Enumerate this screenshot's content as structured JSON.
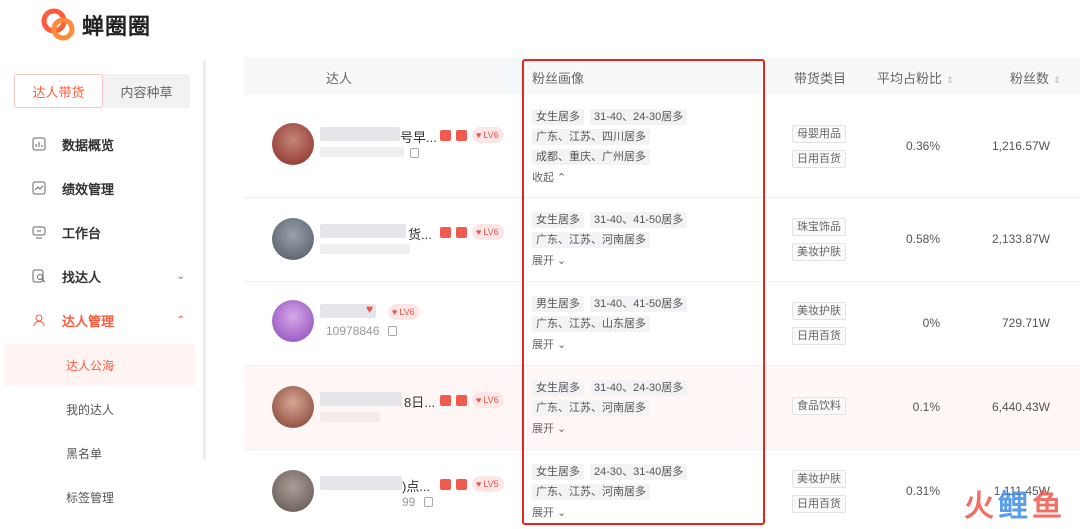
{
  "brand": {
    "name": "蝉圈圈",
    "accent": "#ff5a3c"
  },
  "sidebar": {
    "tabs": [
      {
        "label": "达人带货",
        "active": true
      },
      {
        "label": "内容种草",
        "active": false
      }
    ],
    "items": [
      {
        "label": "数据概览",
        "icon": "chart-icon"
      },
      {
        "label": "绩效管理",
        "icon": "trend-icon"
      },
      {
        "label": "工作台",
        "icon": "monitor-icon"
      },
      {
        "label": "找达人",
        "icon": "search-user-icon",
        "chevron": "⌄"
      },
      {
        "label": "达人管理",
        "icon": "user-icon",
        "chevron": "⌃",
        "open": true
      }
    ],
    "subitems": [
      {
        "label": "达人公海",
        "active": true
      },
      {
        "label": "我的达人"
      },
      {
        "label": "黑名单"
      },
      {
        "label": "标签管理"
      }
    ]
  },
  "table": {
    "headers": {
      "creator": "达人",
      "fans_profile": "粉丝画像",
      "category": "带货类目",
      "avg_ratio": "平均占粉比",
      "fans": "粉丝数",
      "sort": "⇕"
    },
    "rows": [
      {
        "name_tail": "号早...",
        "level": "LV6",
        "sub": "",
        "tags": [
          [
            "女生居多",
            "31-40、24-30居多"
          ],
          [
            "广东、江苏、四川居多"
          ],
          [
            "成都、重庆、广州居多"
          ]
        ],
        "toggle": "收起 ⌃",
        "categories": [
          "母婴用品",
          "日用百货"
        ],
        "ratio": "0.36%",
        "fans": "1,216.57W"
      },
      {
        "name_tail": "货...",
        "level": "LV6",
        "sub": "",
        "tags": [
          [
            "女生居多",
            "31-40、41-50居多"
          ],
          [
            "广东、江苏、河南居多"
          ]
        ],
        "toggle": "展开 ⌄",
        "categories": [
          "珠宝饰品",
          "美妆护肤"
        ],
        "ratio": "0.58%",
        "fans": "2,133.87W"
      },
      {
        "name_tail": "",
        "level": "LV6",
        "sub": "10978846",
        "tags": [
          [
            "男生居多",
            "31-40、41-50居多"
          ],
          [
            "广东、江苏、山东居多"
          ]
        ],
        "toggle": "展开 ⌄",
        "categories": [
          "美妆护肤",
          "日用百货"
        ],
        "ratio": "0%",
        "fans": "729.71W"
      },
      {
        "name_tail": "8日...",
        "level": "LV6",
        "sub": "",
        "tags": [
          [
            "女生居多",
            "31-40、24-30居多"
          ],
          [
            "广东、江苏、河南居多"
          ]
        ],
        "toggle": "展开 ⌄",
        "categories": [
          "食品饮料"
        ],
        "ratio": "0.1%",
        "fans": "6,440.43W"
      },
      {
        "name_tail": ")点...",
        "level": "LV5",
        "sub": "99",
        "tags": [
          [
            "女生居多",
            "24-30、31-40居多"
          ],
          [
            "广东、江苏、河南居多"
          ]
        ],
        "toggle": "展开 ⌄",
        "categories": [
          "美妆护肤",
          "日用百货"
        ],
        "ratio": "0.31%",
        "fans": "1,111.45W"
      }
    ]
  },
  "watermark": {
    "a": "火",
    "b": "鲤",
    "c": "鱼"
  }
}
